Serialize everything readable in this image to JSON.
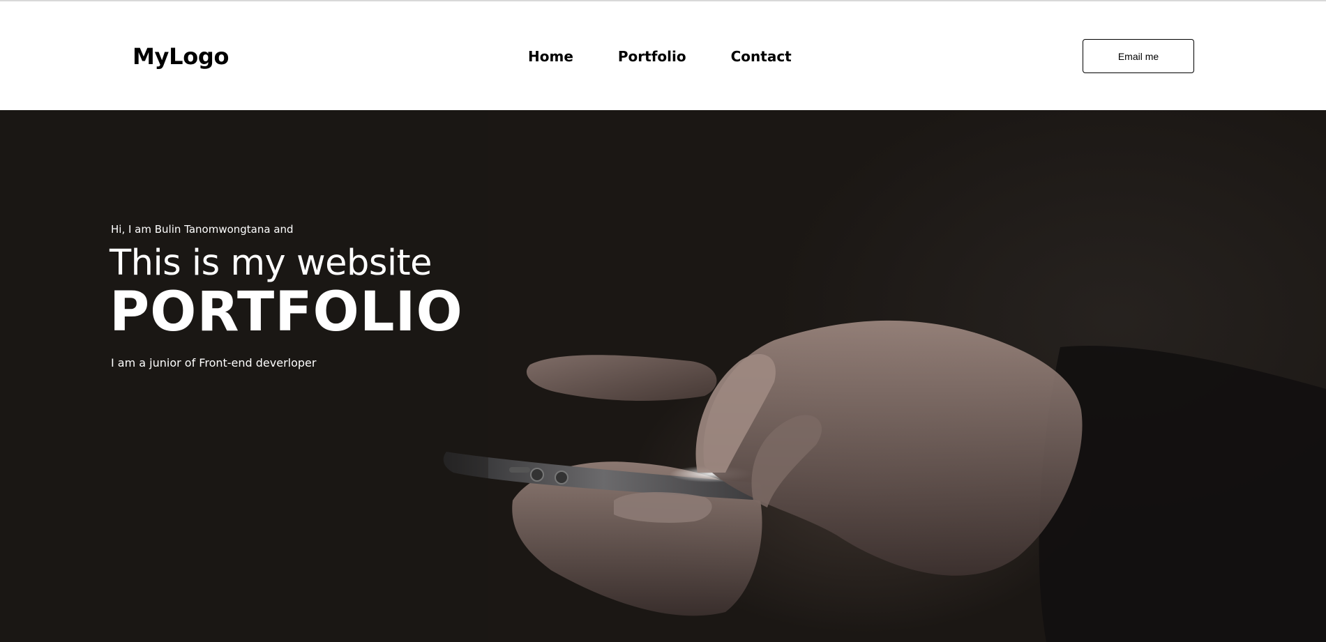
{
  "header": {
    "logo": "MyLogo",
    "nav": [
      {
        "label": "Home"
      },
      {
        "label": "Portfolio"
      },
      {
        "label": "Contact"
      }
    ],
    "email_button": "Email me"
  },
  "hero": {
    "intro": "Hi, I am Bulin Tanomwongtana and",
    "headline": "This is my website",
    "title": "PORTFOLIO",
    "tagline": "I am a junior of Front-end deverloper",
    "background_color": "#1b1714",
    "image_subject": "hands-holding-smartphone"
  }
}
